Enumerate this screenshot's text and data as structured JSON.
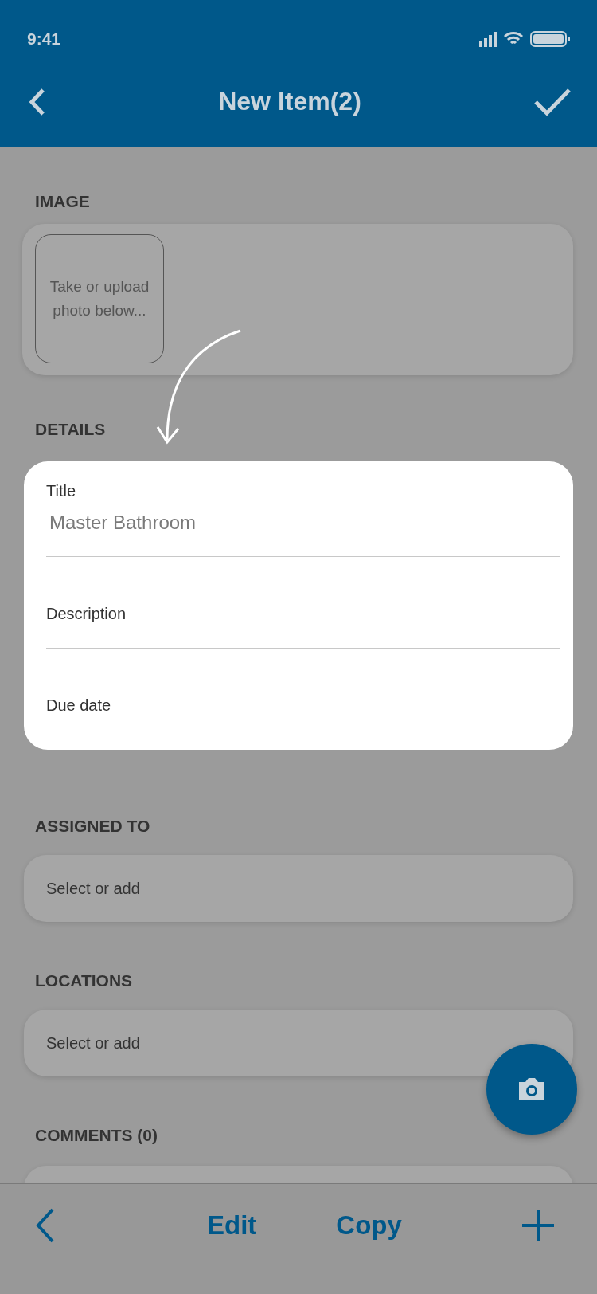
{
  "status_bar": {
    "time": "9:41"
  },
  "header": {
    "title": "New Item(2)"
  },
  "image_section": {
    "label": "IMAGE",
    "placeholder": "Take or upload photo below..."
  },
  "details": {
    "label": "DETAILS",
    "fields": [
      {
        "label": "Title",
        "value": "Master Bathroom"
      },
      {
        "label": "Description"
      },
      {
        "label": "Due date"
      }
    ]
  },
  "pickers": [
    {
      "label": "ASSIGNED TO",
      "placeholder": "Select or add"
    },
    {
      "label": "LOCATIONS",
      "placeholder": "Select or add"
    }
  ],
  "comments": {
    "label": "COMMENTS (0)"
  },
  "bottom_bar": {
    "buttons": [
      "Edit",
      "Copy"
    ]
  }
}
